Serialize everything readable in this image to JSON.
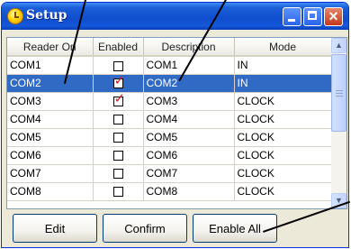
{
  "window": {
    "title": "Setup",
    "controls": {
      "minimize": "",
      "maximize": "",
      "close": "×"
    }
  },
  "table": {
    "columns": [
      "Reader On",
      "Enabled",
      "Description",
      "Mode"
    ],
    "rows": [
      {
        "reader": "COM1",
        "enabled": false,
        "description": "COM1",
        "mode": "IN"
      },
      {
        "reader": "COM2",
        "enabled": true,
        "description": "COM2",
        "mode": "IN",
        "selected": true
      },
      {
        "reader": "COM3",
        "enabled": true,
        "description": "COM3",
        "mode": "CLOCK"
      },
      {
        "reader": "COM4",
        "enabled": false,
        "description": "COM4",
        "mode": "CLOCK"
      },
      {
        "reader": "COM5",
        "enabled": false,
        "description": "COM5",
        "mode": "CLOCK"
      },
      {
        "reader": "COM6",
        "enabled": false,
        "description": "COM6",
        "mode": "CLOCK"
      },
      {
        "reader": "COM7",
        "enabled": false,
        "description": "COM7",
        "mode": "CLOCK"
      },
      {
        "reader": "COM8",
        "enabled": false,
        "description": "COM8",
        "mode": "CLOCK"
      }
    ]
  },
  "scrollbar": {
    "up_glyph": "▲",
    "down_glyph": "▼"
  },
  "buttons": {
    "edit": "Edit",
    "confirm": "Confirm",
    "enable_all": "Enable All"
  },
  "colors": {
    "selection": "#316ac5",
    "checkmark": "#e01a1a",
    "titlebar": "#0f4dcd"
  }
}
